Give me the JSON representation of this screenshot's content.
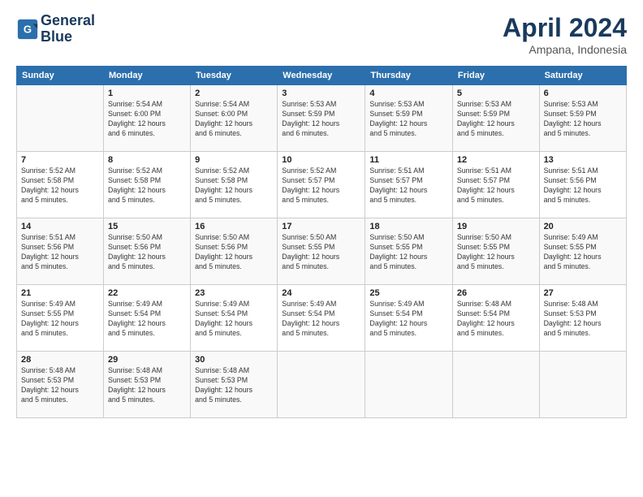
{
  "header": {
    "logo_line1": "General",
    "logo_line2": "Blue",
    "month": "April 2024",
    "location": "Ampana, Indonesia"
  },
  "days_of_week": [
    "Sunday",
    "Monday",
    "Tuesday",
    "Wednesday",
    "Thursday",
    "Friday",
    "Saturday"
  ],
  "weeks": [
    [
      {
        "day": "",
        "info": ""
      },
      {
        "day": "1",
        "info": "Sunrise: 5:54 AM\nSunset: 6:00 PM\nDaylight: 12 hours\nand 6 minutes."
      },
      {
        "day": "2",
        "info": "Sunrise: 5:54 AM\nSunset: 6:00 PM\nDaylight: 12 hours\nand 6 minutes."
      },
      {
        "day": "3",
        "info": "Sunrise: 5:53 AM\nSunset: 5:59 PM\nDaylight: 12 hours\nand 6 minutes."
      },
      {
        "day": "4",
        "info": "Sunrise: 5:53 AM\nSunset: 5:59 PM\nDaylight: 12 hours\nand 5 minutes."
      },
      {
        "day": "5",
        "info": "Sunrise: 5:53 AM\nSunset: 5:59 PM\nDaylight: 12 hours\nand 5 minutes."
      },
      {
        "day": "6",
        "info": "Sunrise: 5:53 AM\nSunset: 5:59 PM\nDaylight: 12 hours\nand 5 minutes."
      }
    ],
    [
      {
        "day": "7",
        "info": "Sunrise: 5:52 AM\nSunset: 5:58 PM\nDaylight: 12 hours\nand 5 minutes."
      },
      {
        "day": "8",
        "info": "Sunrise: 5:52 AM\nSunset: 5:58 PM\nDaylight: 12 hours\nand 5 minutes."
      },
      {
        "day": "9",
        "info": "Sunrise: 5:52 AM\nSunset: 5:58 PM\nDaylight: 12 hours\nand 5 minutes."
      },
      {
        "day": "10",
        "info": "Sunrise: 5:52 AM\nSunset: 5:57 PM\nDaylight: 12 hours\nand 5 minutes."
      },
      {
        "day": "11",
        "info": "Sunrise: 5:51 AM\nSunset: 5:57 PM\nDaylight: 12 hours\nand 5 minutes."
      },
      {
        "day": "12",
        "info": "Sunrise: 5:51 AM\nSunset: 5:57 PM\nDaylight: 12 hours\nand 5 minutes."
      },
      {
        "day": "13",
        "info": "Sunrise: 5:51 AM\nSunset: 5:56 PM\nDaylight: 12 hours\nand 5 minutes."
      }
    ],
    [
      {
        "day": "14",
        "info": "Sunrise: 5:51 AM\nSunset: 5:56 PM\nDaylight: 12 hours\nand 5 minutes."
      },
      {
        "day": "15",
        "info": "Sunrise: 5:50 AM\nSunset: 5:56 PM\nDaylight: 12 hours\nand 5 minutes."
      },
      {
        "day": "16",
        "info": "Sunrise: 5:50 AM\nSunset: 5:56 PM\nDaylight: 12 hours\nand 5 minutes."
      },
      {
        "day": "17",
        "info": "Sunrise: 5:50 AM\nSunset: 5:55 PM\nDaylight: 12 hours\nand 5 minutes."
      },
      {
        "day": "18",
        "info": "Sunrise: 5:50 AM\nSunset: 5:55 PM\nDaylight: 12 hours\nand 5 minutes."
      },
      {
        "day": "19",
        "info": "Sunrise: 5:50 AM\nSunset: 5:55 PM\nDaylight: 12 hours\nand 5 minutes."
      },
      {
        "day": "20",
        "info": "Sunrise: 5:49 AM\nSunset: 5:55 PM\nDaylight: 12 hours\nand 5 minutes."
      }
    ],
    [
      {
        "day": "21",
        "info": "Sunrise: 5:49 AM\nSunset: 5:55 PM\nDaylight: 12 hours\nand 5 minutes."
      },
      {
        "day": "22",
        "info": "Sunrise: 5:49 AM\nSunset: 5:54 PM\nDaylight: 12 hours\nand 5 minutes."
      },
      {
        "day": "23",
        "info": "Sunrise: 5:49 AM\nSunset: 5:54 PM\nDaylight: 12 hours\nand 5 minutes."
      },
      {
        "day": "24",
        "info": "Sunrise: 5:49 AM\nSunset: 5:54 PM\nDaylight: 12 hours\nand 5 minutes."
      },
      {
        "day": "25",
        "info": "Sunrise: 5:49 AM\nSunset: 5:54 PM\nDaylight: 12 hours\nand 5 minutes."
      },
      {
        "day": "26",
        "info": "Sunrise: 5:48 AM\nSunset: 5:54 PM\nDaylight: 12 hours\nand 5 minutes."
      },
      {
        "day": "27",
        "info": "Sunrise: 5:48 AM\nSunset: 5:53 PM\nDaylight: 12 hours\nand 5 minutes."
      }
    ],
    [
      {
        "day": "28",
        "info": "Sunrise: 5:48 AM\nSunset: 5:53 PM\nDaylight: 12 hours\nand 5 minutes."
      },
      {
        "day": "29",
        "info": "Sunrise: 5:48 AM\nSunset: 5:53 PM\nDaylight: 12 hours\nand 5 minutes."
      },
      {
        "day": "30",
        "info": "Sunrise: 5:48 AM\nSunset: 5:53 PM\nDaylight: 12 hours\nand 5 minutes."
      },
      {
        "day": "",
        "info": ""
      },
      {
        "day": "",
        "info": ""
      },
      {
        "day": "",
        "info": ""
      },
      {
        "day": "",
        "info": ""
      }
    ]
  ]
}
